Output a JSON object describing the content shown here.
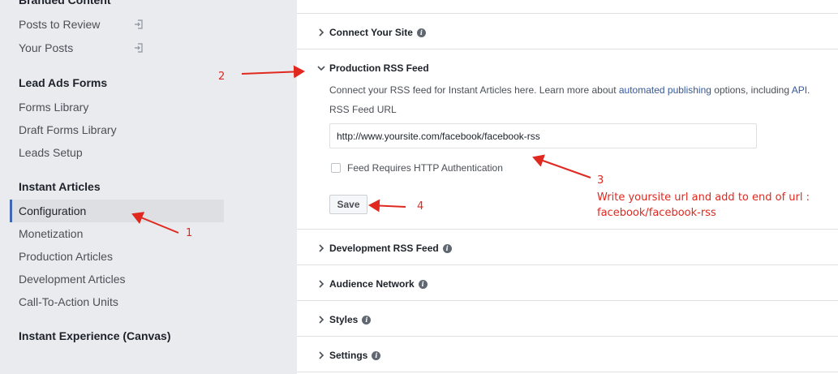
{
  "sidebar": {
    "sections": [
      {
        "heading": "Branded Content",
        "items": [
          "Posts to Review",
          "Your Posts"
        ]
      },
      {
        "heading": "Lead Ads Forms",
        "items": [
          "Forms Library",
          "Draft Forms Library",
          "Leads Setup"
        ]
      },
      {
        "heading": "Instant Articles",
        "items": [
          "Configuration",
          "Monetization",
          "Production Articles",
          "Development Articles",
          "Call-To-Action Units"
        ]
      },
      {
        "heading": "Instant Experience (Canvas)",
        "items": []
      }
    ],
    "active_item": "Configuration"
  },
  "main": {
    "sections": [
      {
        "title": "Connect Your Site",
        "expanded": false,
        "has_info": true
      },
      {
        "title": "Production RSS Feed",
        "expanded": true,
        "has_info": false
      },
      {
        "title": "Development RSS Feed",
        "expanded": false,
        "has_info": true
      },
      {
        "title": "Audience Network",
        "expanded": false,
        "has_info": true
      },
      {
        "title": "Styles",
        "expanded": false,
        "has_info": true
      },
      {
        "title": "Settings",
        "expanded": false,
        "has_info": true
      }
    ],
    "production_feed": {
      "description_prefix": "Connect your RSS feed for Instant Articles here. Learn more about ",
      "link_automated_publishing": "automated publishing",
      "description_middle": " options, including ",
      "link_api": "API",
      "description_suffix": ".",
      "url_label": "RSS Feed URL",
      "url_value": "http://www.yoursite.com/facebook/facebook-rss",
      "http_auth_label": "Feed Requires HTTP Authentication",
      "http_auth_checked": false,
      "save_label": "Save"
    },
    "info_glyph": "i"
  },
  "annotations": {
    "n1": "1",
    "n2": "2",
    "n3": "3",
    "n4": "4",
    "note_line1": "Write yoursite url and add to end of url :",
    "note_line2": "facebook/facebook-rss",
    "color": "#e0281f"
  },
  "colors": {
    "sidebar_bg": "#e9ebee",
    "active_bar": "#4267b2",
    "link": "#365899"
  },
  "icons": {
    "sidebar_external": "external-link-icon",
    "collapsed": "chevron-right-icon",
    "expanded": "chevron-down-icon",
    "info": "info-icon"
  }
}
